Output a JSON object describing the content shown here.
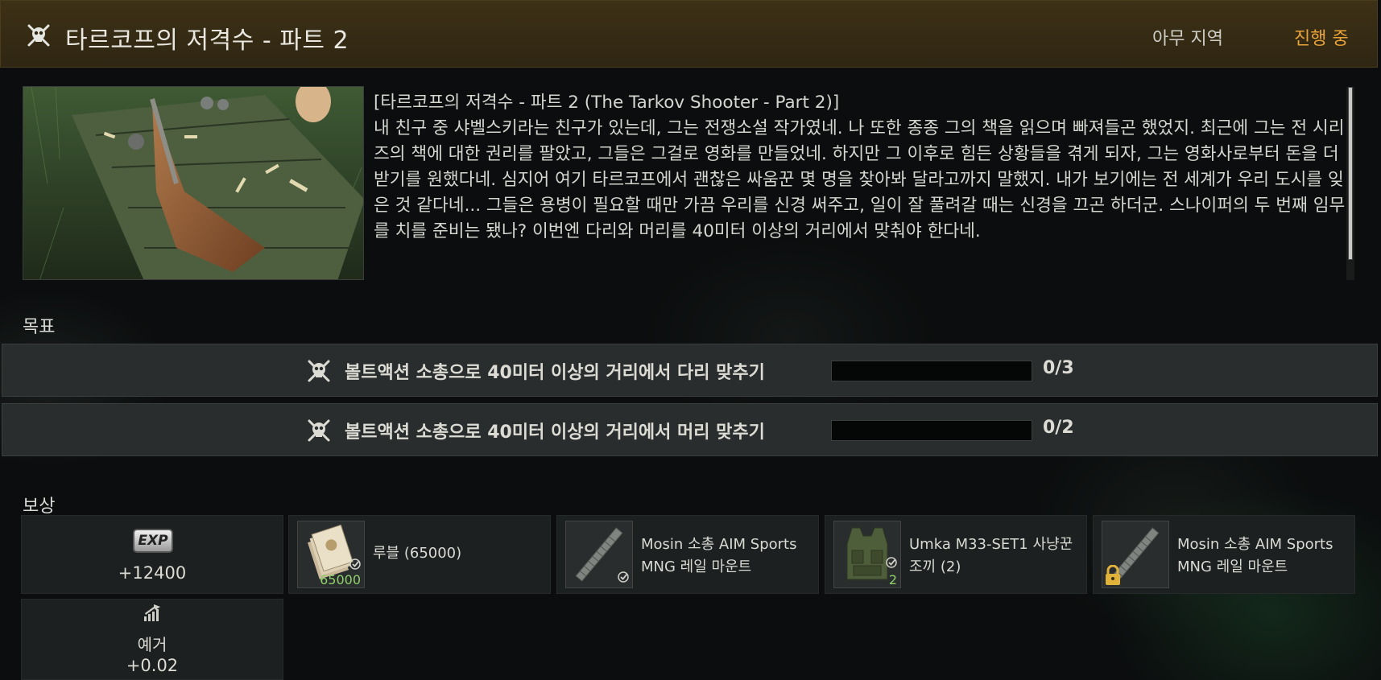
{
  "header": {
    "title": "타르코프의 저격수 - 파트 2",
    "location": "아무 지역",
    "status": "진행 중",
    "status_color": "#e8a23a",
    "icon": "skull-crossbones-icon"
  },
  "description": {
    "line1": "[타르코프의 저격수 - 파트 2 (The Tarkov Shooter - Part 2)]",
    "body": "내 친구 중 샤벨스키라는 친구가 있는데, 그는 전쟁소설 작가였네. 나 또한 종종 그의 책을 읽으며 빠져들곤 했었지. 최근에 그는 전 시리즈의 책에 대한 권리를 팔았고, 그들은 그걸로 영화를 만들었네. 하지만 그 이후로 힘든 상황들을 겪게 되자, 그는 영화사로부터 돈을 더 받기를 원했다네. 심지어 여기 타르코프에서 괜찮은 싸움꾼 몇 명을 찾아봐 달라고까지 말했지. 내가 보기에는 전 세계가 우리 도시를 잊은 것 같다네... 그들은 용병이 필요할 때만 가끔 우리를 신경 써주고, 일이 잘 풀려갈 때는 신경을 끄곤 하더군. 스나이퍼의 두 번째 임무를 치를 준비는 됐나? 이번엔 다리와 머리를 40미터 이상의 거리에서 맞춰야 한다네."
  },
  "objectives": {
    "label": "목표",
    "items": [
      {
        "text": "볼트액션 소총으로 40미터 이상의 거리에서 다리 맞추기",
        "progress": 0,
        "count": "0/3"
      },
      {
        "text": "볼트액션 소총으로 40미터 이상의 거리에서 머리 맞추기",
        "progress": 0,
        "count": "0/2"
      }
    ]
  },
  "rewards": {
    "label": "보상",
    "exp": {
      "badge": "EXP",
      "value": "+12400"
    },
    "reputation": {
      "label": "예거",
      "value": "+0.02"
    },
    "items": [
      {
        "name": "루블 (65000)",
        "qty": "65000",
        "icon": "roubles-icon",
        "check": true,
        "locked": false
      },
      {
        "name": "Mosin 소총 AIM Sports MNG 레일 마운트",
        "qty": "",
        "icon": "rail-mount-icon",
        "check": true,
        "locked": false
      },
      {
        "name": "Umka M33-SET1 사냥꾼 조끼 (2)",
        "qty": "2",
        "icon": "vest-icon",
        "check": true,
        "locked": false
      },
      {
        "name": "Mosin 소총 AIM Sports MNG 레일 마운트",
        "qty": "",
        "icon": "rail-mount-icon",
        "check": false,
        "locked": true
      }
    ]
  }
}
